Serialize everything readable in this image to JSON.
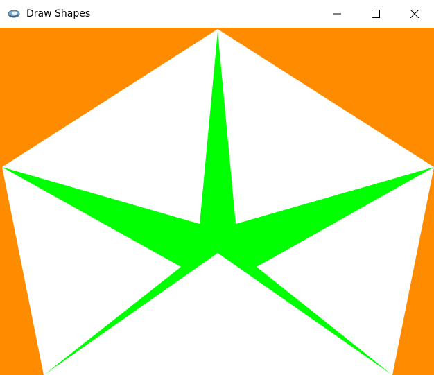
{
  "window": {
    "title": "Draw Shapes",
    "icon": "app-window-icon"
  },
  "titlebar_controls": {
    "minimize_icon": "minimize-icon",
    "maximize_icon": "maximize-icon",
    "close_icon": "close-icon"
  },
  "canvas": {
    "background_color": "#FF8C00",
    "pentagon_color": "#FFFFFF",
    "star_color": "#00FF00",
    "shapes": [
      "pentagon",
      "star"
    ]
  }
}
